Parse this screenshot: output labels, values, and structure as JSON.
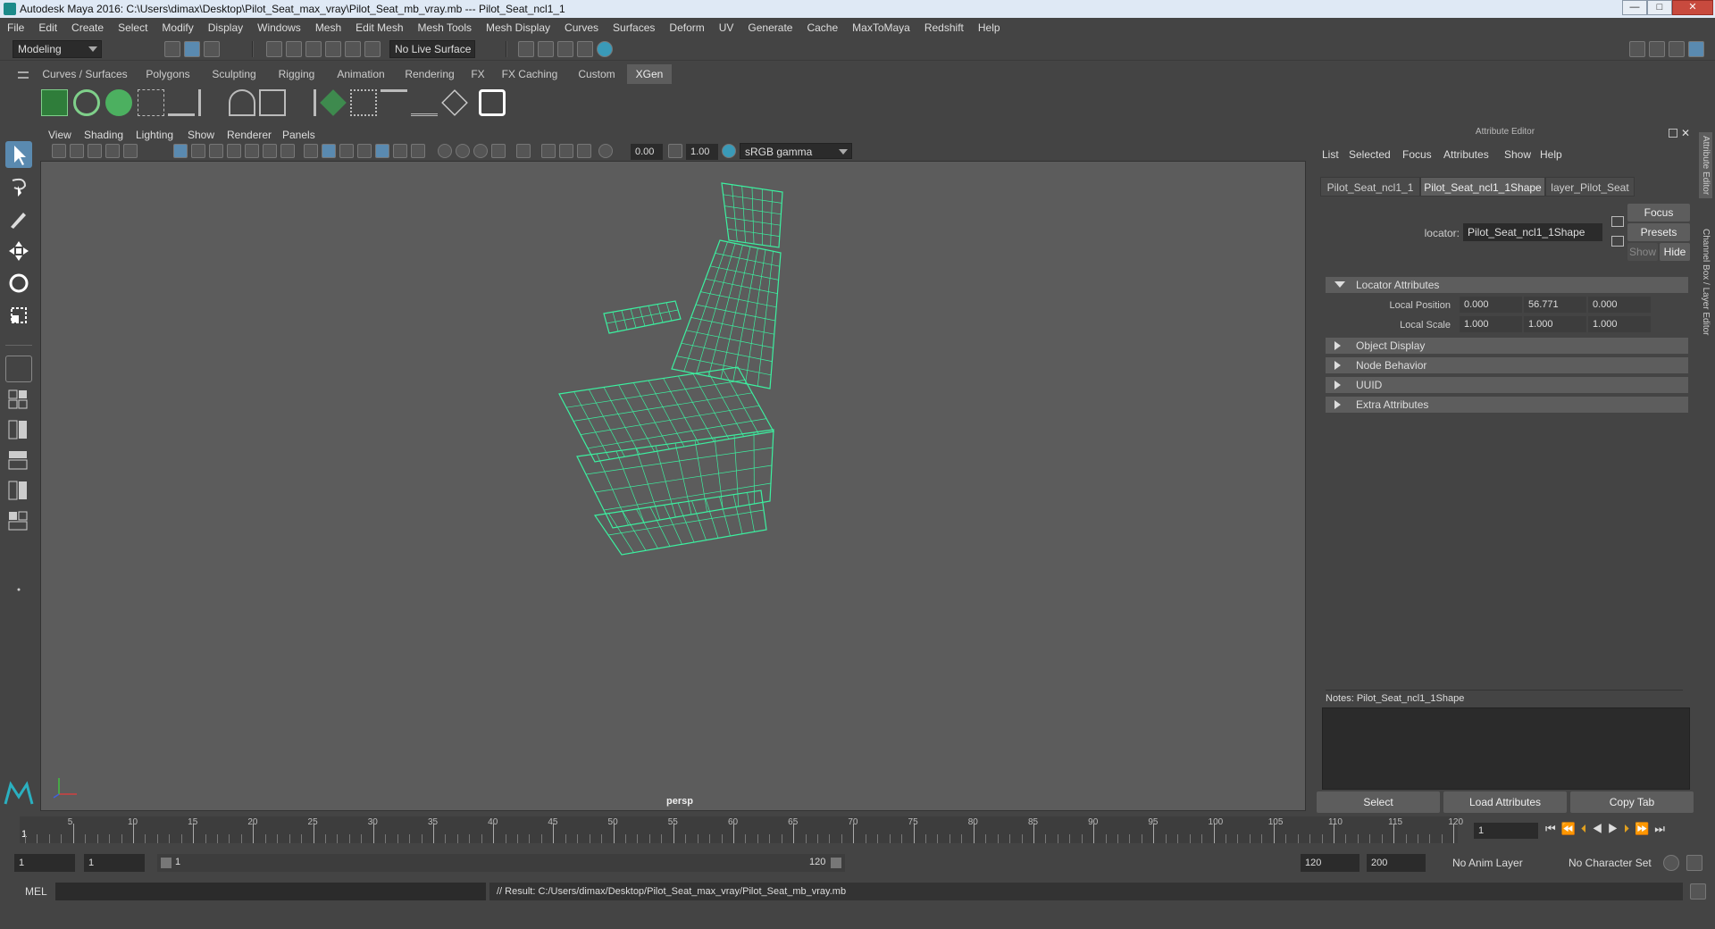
{
  "window": {
    "title": "Autodesk Maya 2016: C:\\Users\\dimax\\Desktop\\Pilot_Seat_max_vray\\Pilot_Seat_mb_vray.mb   ---   Pilot_Seat_ncl1_1",
    "minimize": "—",
    "maximize": "□",
    "close": "✕"
  },
  "menubar": [
    "File",
    "Edit",
    "Create",
    "Select",
    "Modify",
    "Display",
    "Windows",
    "Mesh",
    "Edit Mesh",
    "Mesh Tools",
    "Mesh Display",
    "Curves",
    "Surfaces",
    "Deform",
    "UV",
    "Generate",
    "Cache",
    "MaxToMaya",
    "Redshift",
    "Help"
  ],
  "status": {
    "mode": "Modeling",
    "live_surface": "No Live Surface"
  },
  "shelf_tabs": [
    "Curves / Surfaces",
    "Polygons",
    "Sculpting",
    "Rigging",
    "Animation",
    "Rendering",
    "FX",
    "FX Caching",
    "Custom",
    "XGen"
  ],
  "shelf_active": "XGen",
  "viewport": {
    "menu": [
      "View",
      "Shading",
      "Lighting",
      "Show",
      "Renderer",
      "Panels"
    ],
    "exposure": "0.00",
    "gamma": "1.00",
    "color_space": "sRGB gamma",
    "camera_label": "persp",
    "wire_color": "#3cf0a0"
  },
  "attribute_editor": {
    "title": "Attribute Editor",
    "menu": [
      "List",
      "Selected",
      "Focus",
      "Attributes",
      "Show",
      "Help"
    ],
    "tabs": [
      "Pilot_Seat_ncl1_1",
      "Pilot_Seat_ncl1_1Shape",
      "layer_Pilot_Seat"
    ],
    "active_tab": "Pilot_Seat_ncl1_1Shape",
    "locator_label": "locator:",
    "locator_value": "Pilot_Seat_ncl1_1Shape",
    "focus_btn": "Focus",
    "presets_btn": "Presets",
    "show_btn": "Show",
    "hide_btn": "Hide",
    "sections": {
      "locator_attributes": "Locator Attributes",
      "local_position_label": "Local Position",
      "local_position": [
        "0.000",
        "56.771",
        "0.000"
      ],
      "local_scale_label": "Local Scale",
      "local_scale": [
        "1.000",
        "1.000",
        "1.000"
      ],
      "object_display": "Object Display",
      "node_behavior": "Node Behavior",
      "uuid": "UUID",
      "extra_attributes": "Extra Attributes"
    },
    "notes_label": "Notes:  Pilot_Seat_ncl1_1Shape",
    "bottom_buttons": [
      "Select",
      "Load Attributes",
      "Copy Tab"
    ],
    "side_tabs": [
      "Attribute Editor",
      "Channel Box / Layer Editor"
    ]
  },
  "timeline": {
    "ticks": [
      "5",
      "10",
      "15",
      "20",
      "25",
      "30",
      "35",
      "40",
      "45",
      "50",
      "55",
      "60",
      "65",
      "70",
      "75",
      "80",
      "85",
      "90",
      "95",
      "100",
      "105",
      "110",
      "115",
      "120"
    ],
    "start_marker": "1",
    "current_frame": "1"
  },
  "range": {
    "start": "1",
    "playback_start": "1",
    "slider_start": "1",
    "slider_end": "120",
    "playback_end": "120",
    "end": "200",
    "anim_layer": "No Anim Layer",
    "character_set": "No Character Set"
  },
  "command": {
    "lang": "MEL",
    "result": "// Result: C:/Users/dimax/Desktop/Pilot_Seat_max_vray/Pilot_Seat_mb_vray.mb"
  }
}
